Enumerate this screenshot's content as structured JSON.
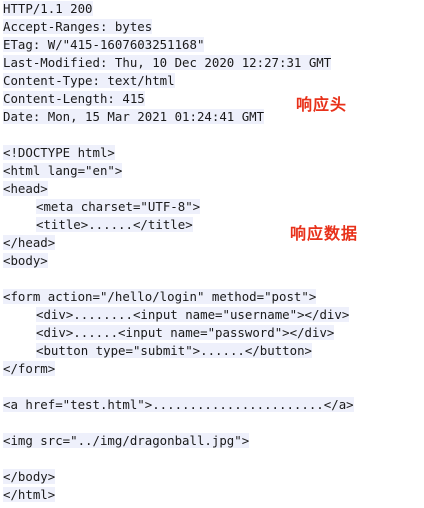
{
  "response_headers": [
    "HTTP/1.1 200",
    "Accept-Ranges: bytes",
    "ETag: W/\"415-1607603251168\"",
    "Last-Modified: Thu, 10 Dec 2020 12:27:31 GMT",
    "Content-Type: text/html",
    "Content-Length: 415",
    "Date: Mon, 15 Mar 2021 01:24:41 GMT"
  ],
  "response_body": {
    "doctype": "<!DOCTYPE html>",
    "html_open": "<html lang=\"en\">",
    "head_open": "<head>",
    "meta": "<meta charset=\"UTF-8\">",
    "title": "<title>......</title>",
    "head_close": "</head>",
    "body_open": "<body>",
    "form_open": "<form action=\"/hello/login\" method=\"post\">",
    "input_username": "<div>........<input name=\"username\"></div>",
    "input_password": "<div>......<input name=\"password\"></div>",
    "submit_button": "<button type=\"submit\">......</button>",
    "form_close": "</form>",
    "link": "<a href=\"test.html\">.......................</a>",
    "image": "<img src=\"../img/dragonball.jpg\">",
    "body_close": "</body>",
    "html_close": "</html>"
  },
  "annotations": {
    "headers_label": "响应头",
    "body_label": "响应数据"
  }
}
